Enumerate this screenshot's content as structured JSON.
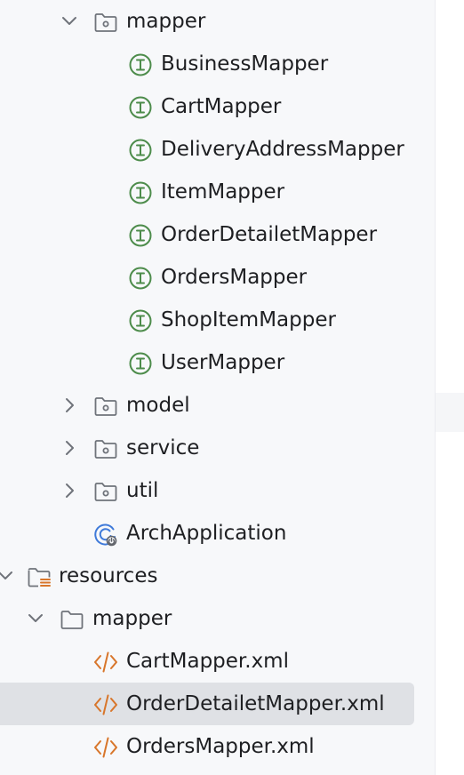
{
  "tree": {
    "rows": [
      {
        "label": "mapper",
        "icon": "package-folder-icon",
        "chevron": "expanded"
      },
      {
        "label": "BusinessMapper",
        "icon": "interface-icon"
      },
      {
        "label": "CartMapper",
        "icon": "interface-icon"
      },
      {
        "label": "DeliveryAddressMapper",
        "icon": "interface-icon"
      },
      {
        "label": "ItemMapper",
        "icon": "interface-icon"
      },
      {
        "label": "OrderDetailetMapper",
        "icon": "interface-icon"
      },
      {
        "label": "OrdersMapper",
        "icon": "interface-icon"
      },
      {
        "label": "ShopItemMapper",
        "icon": "interface-icon"
      },
      {
        "label": "UserMapper",
        "icon": "interface-icon"
      },
      {
        "label": "model",
        "icon": "package-folder-icon",
        "chevron": "collapsed"
      },
      {
        "label": "service",
        "icon": "package-folder-icon",
        "chevron": "collapsed"
      },
      {
        "label": "util",
        "icon": "package-folder-icon",
        "chevron": "collapsed"
      },
      {
        "label": "ArchApplication",
        "icon": "spring-boot-app-icon"
      },
      {
        "label": "resources",
        "icon": "resources-folder-icon",
        "chevron": "expanded"
      },
      {
        "label": "mapper",
        "icon": "folder-icon",
        "chevron": "expanded"
      },
      {
        "label": "CartMapper.xml",
        "icon": "xml-file-icon"
      },
      {
        "label": "OrderDetailetMapper.xml",
        "icon": "xml-file-icon",
        "selected": true
      },
      {
        "label": "OrdersMapper.xml",
        "icon": "xml-file-icon"
      }
    ]
  },
  "colors": {
    "interface": "#4d8c4b",
    "xml": "#d8762b",
    "spring": "#3f7ad9",
    "folder": "#6f737a",
    "text": "#1e1f22",
    "selection": "#dfe1e5"
  }
}
